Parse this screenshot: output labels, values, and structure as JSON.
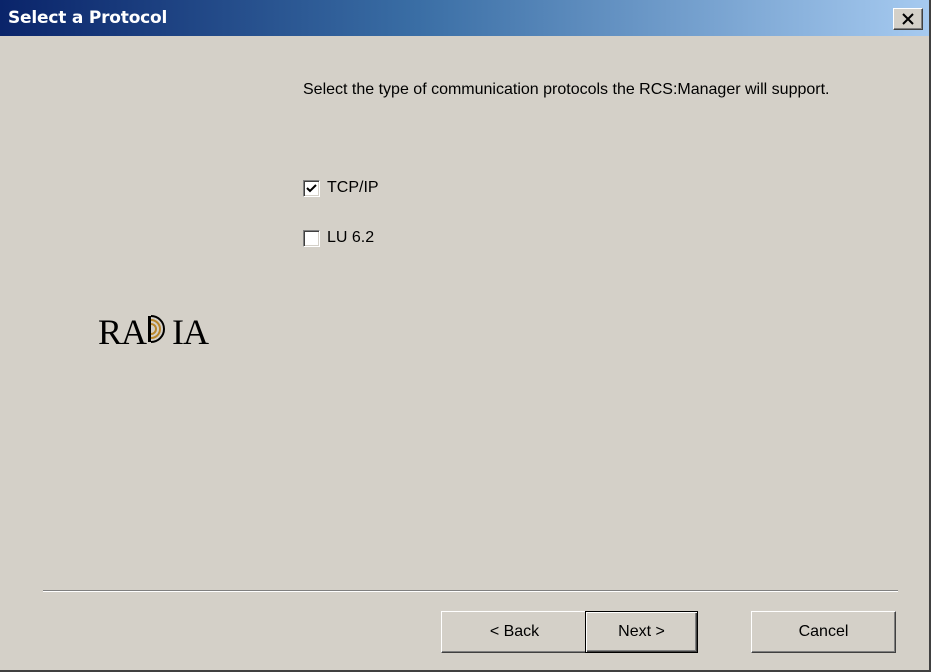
{
  "window": {
    "title": "Select a Protocol",
    "close_label": "×"
  },
  "content": {
    "description": "Select the type of communication protocols the RCS:Manager will support.",
    "options": [
      {
        "label": "TCP/IP",
        "checked": true
      },
      {
        "label": "LU 6.2",
        "checked": false
      }
    ]
  },
  "logo": {
    "text_left": "RA",
    "text_right": "IA"
  },
  "buttons": {
    "back": "< Back",
    "next": "Next >",
    "cancel": "Cancel"
  },
  "colors": {
    "dialog_bg": "#d4d0c8",
    "title_gradient_start": "#0a246a",
    "title_gradient_end": "#a6caf0",
    "logo_accent": "#b8862b"
  }
}
